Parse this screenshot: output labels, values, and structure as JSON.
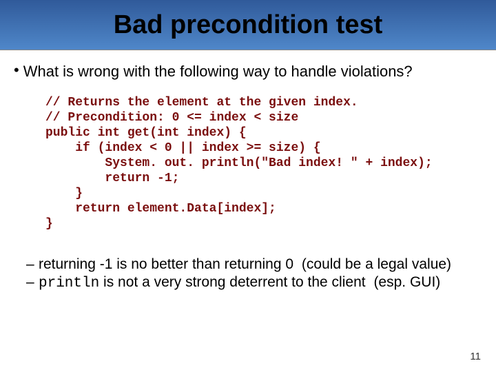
{
  "header": {
    "title": "Bad precondition test"
  },
  "question": "What is wrong with the following way to handle violations?",
  "code": "// Returns the element at the given index.\n// Precondition: 0 <= index < size\npublic int get(int index) {\n    if (index < 0 || index >= size) {\n        System. out. println(\"Bad index! \" + index);\n        return -1;\n    }\n    return element.Data[index];\n}",
  "dashes": {
    "item1": {
      "pre": "returning -1 is no better than returning 0",
      "post": "(could be a legal value)"
    },
    "item2": {
      "code": "println",
      "post": " is not a very strong deterrent to the client",
      "tail": "(esp. GUI)"
    }
  },
  "pageNumber": "11"
}
